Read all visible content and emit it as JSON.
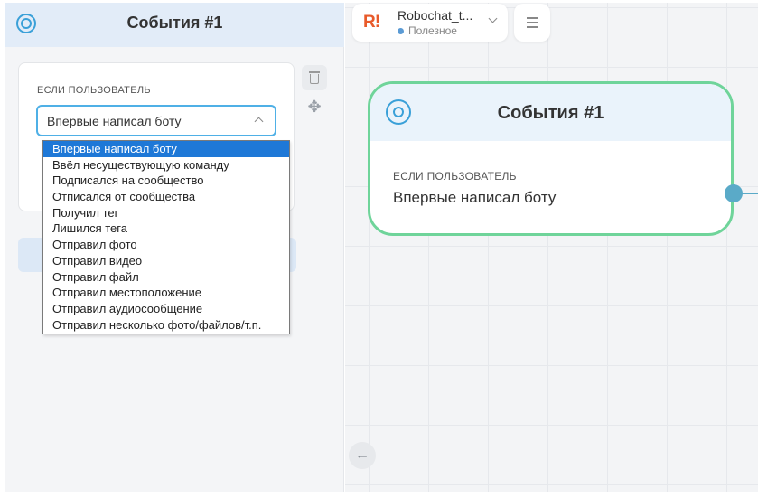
{
  "panel": {
    "title": "События #1",
    "condition_label": "ЕСЛИ ПОЛЬЗОВАТЕЛЬ",
    "selected_value": "Впервые написал боту"
  },
  "dropdown": {
    "options": [
      "Впервые написал боту",
      "Ввёл несуществующую команду",
      "Подписался на сообщество",
      "Отписался от сообщества",
      "Получил тег",
      "Лишился тега",
      "Отправил фото",
      "Отправил видео",
      "Отправил файл",
      "Отправил местоположение",
      "Отправил аудиосообщение",
      "Отправил несколько фото/файлов/т.п."
    ],
    "selected_index": 0
  },
  "bot": {
    "logo": "R!",
    "name": "Robochat_t...",
    "status": "Полезное"
  },
  "node": {
    "title": "События #1",
    "condition_label": "ЕСЛИ ПОЛЬЗОВАТЕЛЬ",
    "condition_value": "Впервые написал боту"
  },
  "icons": {
    "panel": "target-icon",
    "delete": "trash-icon",
    "move": "move-icon",
    "menu": "hamburger-icon",
    "back": "arrow-left-icon"
  },
  "colors": {
    "accent": "#3aa0d8",
    "node_border": "#6fd49a",
    "selected_option": "#1e78d7",
    "logo": "#e85a2a"
  }
}
